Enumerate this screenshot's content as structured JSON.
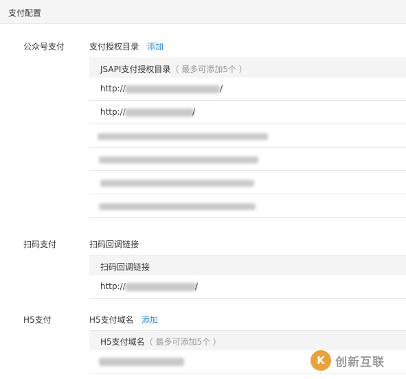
{
  "header": {
    "title": "支付配置"
  },
  "public": {
    "label": "公众号支付",
    "sub_label": "支付授权目录",
    "add_label": "添加",
    "table_title": "JSAPI支付授权目录",
    "table_hint": "（ 最多可添加5个 ）",
    "rows": [
      "http://",
      "http://",
      "",
      "",
      "",
      ""
    ]
  },
  "scan": {
    "label": "扫码支付",
    "sub_label": "扫码回调链接",
    "table_title": "扫码回调链接",
    "rows": [
      "http://"
    ]
  },
  "h5": {
    "label": "H5支付",
    "sub_label": "H5支付域名",
    "add_label": "添加",
    "table_title": "H5支付域名",
    "table_hint": "（ 最多可添加5个 ）",
    "rows": [
      ""
    ]
  },
  "watermark": {
    "text": "创新互联",
    "icon_glyph": "K"
  },
  "colors": {
    "link": "#2a8ad6",
    "header_bg": "#f5f5f5",
    "table_head_bg": "#f4f4f4"
  }
}
